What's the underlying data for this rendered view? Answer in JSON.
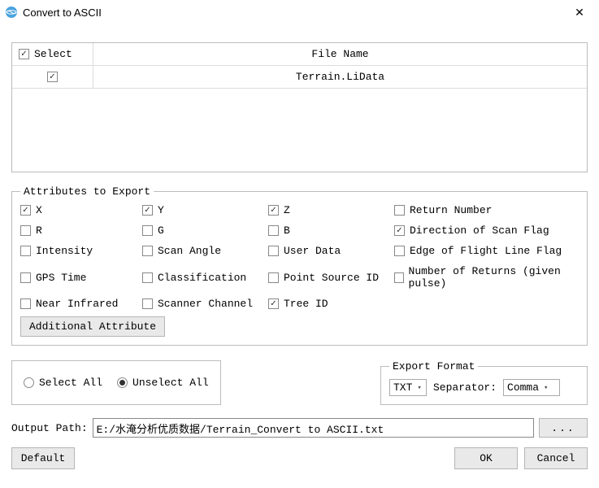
{
  "title": "Convert to ASCII",
  "table": {
    "header_select": "Select",
    "header_filename": "File Name",
    "rows": [
      {
        "selected": true,
        "filename": "Terrain.LiData"
      }
    ]
  },
  "attributes": {
    "legend": "Attributes to Export",
    "items": [
      {
        "label": "X",
        "checked": true
      },
      {
        "label": "Y",
        "checked": true
      },
      {
        "label": "Z",
        "checked": true
      },
      {
        "label": "Return Number",
        "checked": false
      },
      {
        "label": "R",
        "checked": false
      },
      {
        "label": "G",
        "checked": false
      },
      {
        "label": "B",
        "checked": false
      },
      {
        "label": "Direction of Scan Flag",
        "checked": true
      },
      {
        "label": "Intensity",
        "checked": false
      },
      {
        "label": "Scan Angle",
        "checked": false
      },
      {
        "label": "User Data",
        "checked": false
      },
      {
        "label": "Edge of Flight Line Flag",
        "checked": false
      },
      {
        "label": "GPS Time",
        "checked": false
      },
      {
        "label": "Classification",
        "checked": false
      },
      {
        "label": "Point Source ID",
        "checked": false
      },
      {
        "label": "Number of Returns (given pulse)",
        "checked": false
      },
      {
        "label": "Near Infrared",
        "checked": false
      },
      {
        "label": "Scanner Channel",
        "checked": false
      },
      {
        "label": "Tree ID",
        "checked": true
      }
    ],
    "additional_button": "Additional Attribute"
  },
  "selection": {
    "select_all": "Select All",
    "unselect_all": "Unselect All",
    "selected": "unselect_all"
  },
  "export_format": {
    "legend": "Export Format",
    "format_value": "TXT",
    "separator_label": "Separator:",
    "separator_value": "Comma"
  },
  "output": {
    "label": "Output Path:",
    "value": "E:/水淹分析优质数据/Terrain_Convert to ASCII.txt",
    "browse": "..."
  },
  "buttons": {
    "default": "Default",
    "ok": "OK",
    "cancel": "Cancel"
  }
}
